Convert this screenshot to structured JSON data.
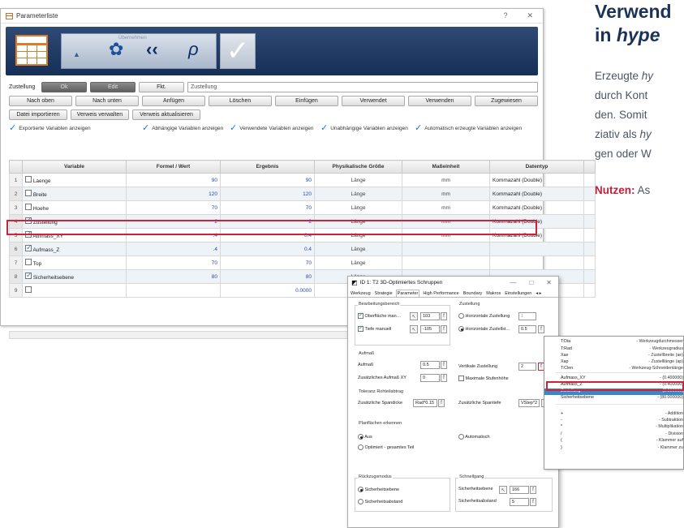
{
  "right_panel": {
    "title_line1": "Verwend",
    "title_line2_prefix": "in ",
    "title_line2_italic": "hype",
    "body_lines": [
      {
        "normal": "Erzeugte ",
        "italic": "hy"
      },
      {
        "normal": "durch Kont",
        "italic": ""
      },
      {
        "normal": "den. Somit",
        "italic": ""
      },
      {
        "normal": "ziativ als ",
        "italic": "hy"
      },
      {
        "normal": "gen oder W",
        "italic": ""
      }
    ],
    "nutzen_label": "Nutzen:",
    "nutzen_text": "As"
  },
  "plist": {
    "title": "Parameterliste",
    "title_controls": [
      "?",
      "✕"
    ],
    "toolbar": {
      "mini_label": "Übernehmen",
      "triangle_glyph": "▲",
      "gear_glyph": "✿",
      "back_glyph": "‹‹",
      "search_glyph": "ρ",
      "check_glyph": "✓"
    },
    "row1": {
      "label": "Zustellung",
      "ok_label": "Ok",
      "edit_label": "Edit",
      "fkt_label": "Fkt.",
      "value": "Zustellung"
    },
    "row2_buttons": [
      "Nach oben",
      "Nach unten",
      "Anfügen",
      "Löschen",
      "Einfügen",
      "Verwendet",
      "Verwenden",
      "Zugewiesen"
    ],
    "row3_buttons": [
      "Datei importieren",
      "Verweis verwalten",
      "Verweis aktualisieren"
    ],
    "filters": [
      "Exportierte Variablen anzeigen",
      "Abhängige Variablen anzeigen",
      "Verwendete Variablen anzeigen",
      "Unabhängige Variablen anzeigen",
      "Automatisch erzeugte Variablen anzeigen"
    ],
    "table": {
      "headers": [
        "Variable",
        "Formel / Wert",
        "Ergebnis",
        "Physikalische Größe",
        "Maßeinheit",
        "Datentyp"
      ],
      "rows": [
        {
          "idx": "1",
          "checked": false,
          "name": "Laenge",
          "formel": "90",
          "ergebnis": "90",
          "groesse": "Länge",
          "einheit": "mm",
          "typ": "Kommazahl (Double)"
        },
        {
          "idx": "2",
          "checked": false,
          "name": "Breite",
          "formel": "120",
          "ergebnis": "120",
          "groesse": "Länge",
          "einheit": "mm",
          "typ": "Kommazahl (Double)"
        },
        {
          "idx": "3",
          "checked": false,
          "name": "Hoehe",
          "formel": "70",
          "ergebnis": "70",
          "groesse": "Länge",
          "einheit": "mm",
          "typ": "Kommazahl (Double)"
        },
        {
          "idx": "4",
          "checked": true,
          "name": "Zustellung",
          "formel": "2",
          "ergebnis": "2",
          "groesse": "Länge",
          "einheit": "mm",
          "typ": "Kommazahl (Double)"
        },
        {
          "idx": "5",
          "checked": true,
          "name": "Aufmass_XY",
          "formel": ".4",
          "ergebnis": "0.4",
          "groesse": "Länge",
          "einheit": "mm",
          "typ": "Kommazahl (Double)"
        },
        {
          "idx": "6",
          "checked": true,
          "name": "Aufmass_Z",
          "formel": ".4",
          "ergebnis": "0.4",
          "groesse": "Länge",
          "einheit": "",
          "typ": ""
        },
        {
          "idx": "7",
          "checked": false,
          "name": "Top",
          "formel": "70",
          "ergebnis": "70",
          "groesse": "Länge",
          "einheit": "",
          "typ": ""
        },
        {
          "idx": "8",
          "checked": true,
          "name": "Sicherheitsebene",
          "formel": "80",
          "ergebnis": "80",
          "groesse": "Länge",
          "einheit": "",
          "typ": ""
        },
        {
          "idx": "9",
          "checked": false,
          "name": "",
          "formel": "",
          "ergebnis": "0.0000",
          "groesse": "",
          "einheit": "",
          "typ": ""
        }
      ]
    }
  },
  "dialog": {
    "title": "ID 1: T2 3D-Optimiertes Schruppen",
    "controls": [
      "—",
      "□",
      "✕"
    ],
    "tabs": [
      "Werkzeug",
      "Strategie",
      "Parameter",
      "High Performance",
      "Boundary",
      "Makros",
      "Einstellungen"
    ],
    "active_tab": "Parameter",
    "tab_arrows": "◂ ▸",
    "groups": {
      "bearbeitung": "Bearbeitungsbereich",
      "zustellung": "Zustellung",
      "aufmass": "Aufmaß",
      "toleranz": "Toleranz Rohteilabtrag",
      "planflaechen": "Planflächen erkennen",
      "rueckzug": "Rückzugsmodus",
      "schnell": "Schnellgang"
    },
    "oberflaeche_label": "Oberfläche man…",
    "oberflaeche_value": "103",
    "tiefe_label": "Tiefe manuell",
    "tiefe_value": "-105",
    "horiz_label": "Horizontale Zustellung",
    "horiz_value": "1",
    "horiz2_label": "Horizontale Zustellst…",
    "horiz2_value": "0.5",
    "aufmass_label": "Aufmaß",
    "aufmass_value": "0.5",
    "aufmass_xy_label": "Zusätzliches Aufmaß XY",
    "aufmass_xy_value": "0",
    "vert_label": "Vertikale Zustellung",
    "vert_value": "2",
    "max_label": "Maximale Stufenhöhe",
    "spandicke_label": "Zusätzliche Spandicke",
    "spandicke_value": "Rad*0.15",
    "spantiefe_label": "Zusätzliche Spantiefe",
    "spantiefe_value": "VStep*2",
    "aus_label": "Aus",
    "auto_label": "Automatisch",
    "optimiert_label": "Optimiert - gesamtes Teil",
    "sicherheitsebene_label": "Sicherheitsebene",
    "sicherheitsabstand_label": "Sicherheitsabstand",
    "schnell_ebene_label": "Sicherheitsebene",
    "schnell_ebene_value": "166",
    "schnell_abstand_label": "Sicherheitsabstand",
    "schnell_abstand_value": "5"
  },
  "popup": {
    "items": [
      {
        "k": "T:Dia",
        "v": "- Werkzeugdurchmesser"
      },
      {
        "k": "T:Rad",
        "v": "- Werkzeugradius"
      },
      {
        "k": "Xae",
        "v": "- Zustellbreite (ae)"
      },
      {
        "k": "Xap",
        "v": "- Zustelllänge (ap)"
      },
      {
        "k": "T:Clen",
        "v": "- Werkzeug-Schneidenlänge"
      },
      {
        "k": "Aufmass_XY",
        "v": "- (0.400000)"
      },
      {
        "k": "Aufmass_Z",
        "v": "- (0.400000)"
      },
      {
        "k": "Zustellung",
        "v": "- (2.000000)"
      },
      {
        "k": "Sicherheitsebene",
        "v": "- (80.000000)"
      },
      {
        "k": "+",
        "v": "- Addition"
      },
      {
        "k": "-",
        "v": "- Subtraktion"
      },
      {
        "k": "*",
        "v": "- Multiplikation"
      },
      {
        "k": "/",
        "v": "- Division"
      },
      {
        "k": "(",
        "v": "- Klammer auf"
      },
      {
        "k": ")",
        "v": "- Klammer zu"
      }
    ],
    "selected_index": 7
  }
}
